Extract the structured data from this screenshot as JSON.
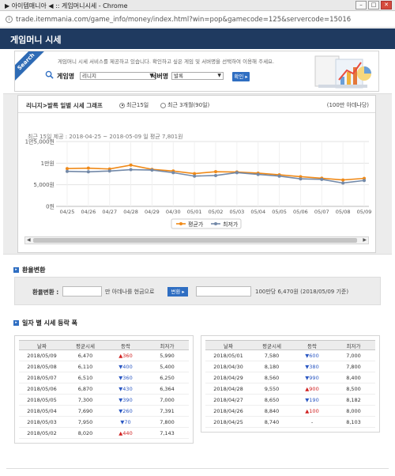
{
  "window": {
    "title": "▶ 아이템매니아 ◀ :: 게임머니시세 - Chrome",
    "url": "trade.itemmania.com/game_info/money/index.html?win=pop&gamecode=125&servercode=15016"
  },
  "header": {
    "title": "게임머니 시세"
  },
  "search": {
    "badge": "Search",
    "intro": "게임머니 시세 서비스를 제공하고 있습니다. 확인하고 싶은 게임 및 서버명을 선택하여 이용해 주세요.",
    "game_label": "게임명",
    "game_value": "리니지",
    "server_label": "서버명",
    "server_value": "발록",
    "confirm": "확인 ▸"
  },
  "graph": {
    "title": "리니지>발록 일별 시세 그래프",
    "options": [
      "최근15일",
      "최근 3개월(90일)"
    ],
    "unit": "(100만 아데나당)",
    "summary": "최근 15일 제공 : 2018-04-25 ~ 2018-05-09 일 평균 7,801원"
  },
  "conversion": {
    "section_title": "환율변환",
    "label": "환율변환 :",
    "input_suffix": "만 아데나를 현금으로",
    "button": "변환 ▸",
    "result_suffix": "100만당 6,470원 (2018/05/09 기준)"
  },
  "daily": {
    "section_title": "일자 별 시세 등락 폭",
    "headers": [
      "날짜",
      "평균시세",
      "등락",
      "최저가"
    ],
    "left": [
      {
        "date": "2018/05/09",
        "avg": "6,470",
        "chg": "▲360",
        "dir": "up",
        "min": "5,990"
      },
      {
        "date": "2018/05/08",
        "avg": "6,110",
        "chg": "▼400",
        "dir": "down",
        "min": "5,400"
      },
      {
        "date": "2018/05/07",
        "avg": "6,510",
        "chg": "▼360",
        "dir": "down",
        "min": "6,250"
      },
      {
        "date": "2018/05/06",
        "avg": "6,870",
        "chg": "▼430",
        "dir": "down",
        "min": "6,364"
      },
      {
        "date": "2018/05/05",
        "avg": "7,300",
        "chg": "▼390",
        "dir": "down",
        "min": "7,000"
      },
      {
        "date": "2018/05/04",
        "avg": "7,690",
        "chg": "▼260",
        "dir": "down",
        "min": "7,391"
      },
      {
        "date": "2018/05/03",
        "avg": "7,950",
        "chg": "▼70",
        "dir": "down",
        "min": "7,800"
      },
      {
        "date": "2018/05/02",
        "avg": "8,020",
        "chg": "▲440",
        "dir": "up",
        "min": "7,143"
      }
    ],
    "right": [
      {
        "date": "2018/05/01",
        "avg": "7,580",
        "chg": "▼600",
        "dir": "down",
        "min": "7,000"
      },
      {
        "date": "2018/04/30",
        "avg": "8,180",
        "chg": "▼380",
        "dir": "down",
        "min": "7,800"
      },
      {
        "date": "2018/04/29",
        "avg": "8,560",
        "chg": "▼990",
        "dir": "down",
        "min": "8,400"
      },
      {
        "date": "2018/04/28",
        "avg": "9,550",
        "chg": "▲900",
        "dir": "up",
        "min": "8,500"
      },
      {
        "date": "2018/04/27",
        "avg": "8,650",
        "chg": "▼190",
        "dir": "down",
        "min": "8,182"
      },
      {
        "date": "2018/04/26",
        "avg": "8,840",
        "chg": "▲100",
        "dir": "up",
        "min": "8,000"
      },
      {
        "date": "2018/04/25",
        "avg": "8,740",
        "chg": "-",
        "dir": "flat",
        "min": "8,103"
      }
    ]
  },
  "chart_data": {
    "type": "line",
    "title": "",
    "y_ticks": [
      "1만5,000원",
      "1만원",
      "5,000원",
      "0원"
    ],
    "ylim": [
      0,
      15000
    ],
    "x": [
      "04/25",
      "04/26",
      "04/27",
      "04/28",
      "04/29",
      "04/30",
      "05/01",
      "05/02",
      "05/03",
      "05/04",
      "05/05",
      "05/06",
      "05/07",
      "05/08",
      "05/09"
    ],
    "series": [
      {
        "name": "평균가",
        "color": "#f08a18",
        "values": [
          8740,
          8840,
          8650,
          9550,
          8560,
          8180,
          7580,
          8020,
          7950,
          7690,
          7300,
          6870,
          6510,
          6110,
          6470
        ]
      },
      {
        "name": "최저가",
        "color": "#7389a8",
        "values": [
          8103,
          8000,
          8182,
          8500,
          8400,
          7800,
          7000,
          7143,
          7800,
          7391,
          7000,
          6364,
          6250,
          5400,
          5990
        ]
      }
    ],
    "grid": true,
    "legend": "bottom"
  }
}
